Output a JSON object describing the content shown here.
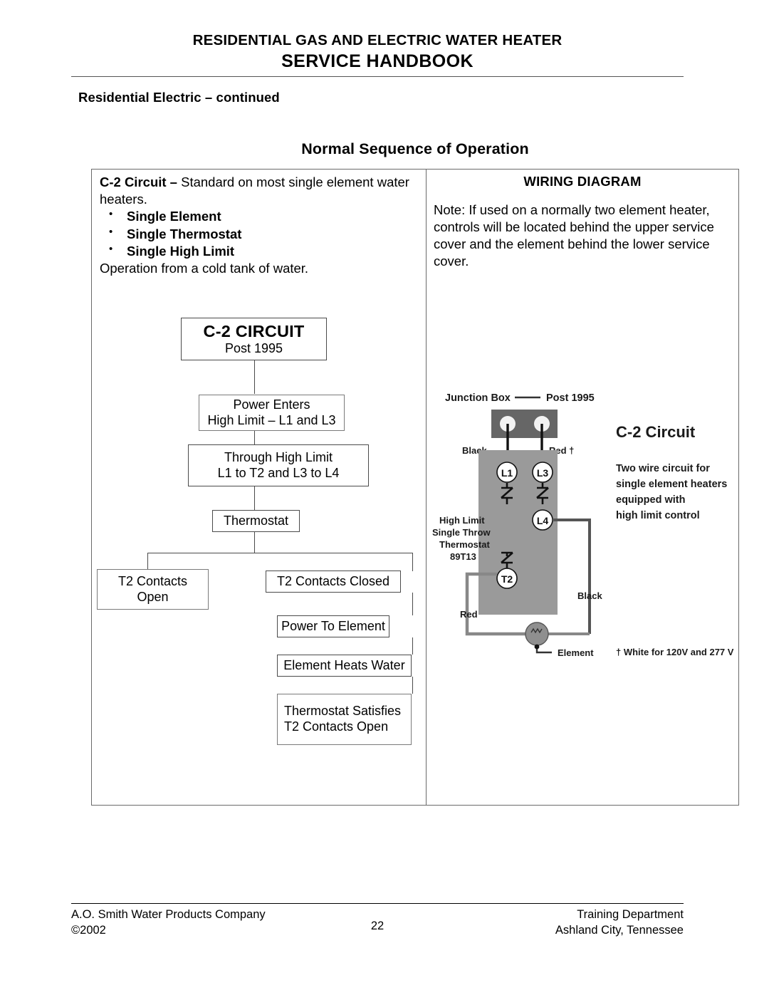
{
  "header": {
    "line1": "RESIDENTIAL GAS AND ELECTRIC WATER HEATER",
    "line2": "SERVICE HANDBOOK",
    "subtitle": "Residential Electric – continued",
    "section_title": "Normal Sequence of Operation"
  },
  "left_column": {
    "lead_bold": "C-2 Circuit –",
    "lead_rest": " Standard on most single element water heaters.",
    "bullets": [
      "Single Element",
      "Single Thermostat",
      "Single High Limit"
    ],
    "closing": "Operation from a cold tank of water."
  },
  "right_column": {
    "title": "WIRING DIAGRAM",
    "note": "Note:  If used on a normally two element heater, controls will be located behind the upper service cover and the element behind the lower service cover."
  },
  "flowchart": {
    "boxes": [
      {
        "id": "c2-circuit",
        "title": "C-2 CIRCUIT",
        "sub": "Post 1995"
      },
      {
        "id": "power-enters",
        "line1": "Power Enters",
        "line2": "High Limit – L1 and L3"
      },
      {
        "id": "through-high-limit",
        "line1": "Through High Limit",
        "line2": "L1 to T2 and L3 to L4"
      },
      {
        "id": "thermostat",
        "line1": "Thermostat"
      },
      {
        "id": "t2-contacts-open",
        "line1": "T2 Contacts",
        "line2": "Open"
      },
      {
        "id": "t2-contacts-closed",
        "line1": "T2 Contacts Closed"
      },
      {
        "id": "power-to-element",
        "line1": "Power To Element"
      },
      {
        "id": "element-heats",
        "line1": "Element Heats Water"
      },
      {
        "id": "thermostat-satisfies",
        "line1": "Thermostat Satisfies",
        "line2": "T2 Contacts Open"
      }
    ]
  },
  "wiring_diagram": {
    "labels": {
      "junction_box": "Junction Box",
      "post_1995": "Post 1995",
      "circuit_name": "C-2 Circuit",
      "desc_line1": "Two wire circuit for",
      "desc_line2": "single element heaters",
      "desc_line3": "equipped with",
      "desc_line4": "high limit control",
      "black_top": "Black",
      "red_top": "Red †",
      "terminal_l1": "L1",
      "terminal_l3": "L3",
      "terminal_l4": "L4",
      "terminal_t2": "T2",
      "high_limit_1": "High Limit",
      "high_limit_2": "Single Throw",
      "high_limit_3": "Thermostat",
      "high_limit_4": "89T13",
      "black_right": "Black",
      "red_left": "Red",
      "element": "Element",
      "footnote": "† White for 120V and 277 V"
    },
    "colors": {
      "box_top": "#666666",
      "box_body": "#9a9a9a",
      "wire": "#555555",
      "element_fill": "#8f8f8f"
    }
  },
  "footer": {
    "company": "A.O. Smith Water Products Company",
    "copyright": "©2002",
    "page_number": "22",
    "department": "Training Department",
    "location": "Ashland City, Tennessee"
  }
}
